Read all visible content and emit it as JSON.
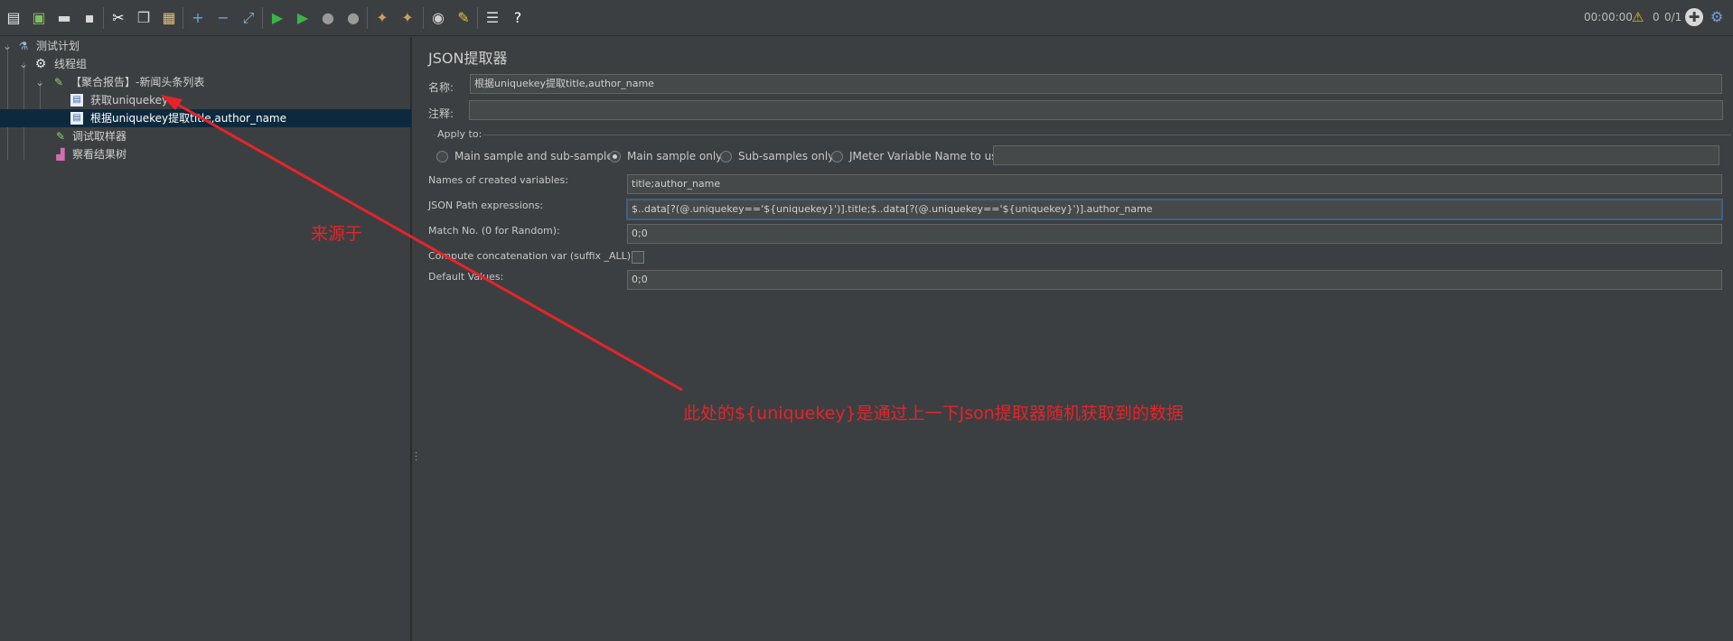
{
  "toolbar": {
    "buttons": [
      {
        "name": "new-icon",
        "glyph": "▤",
        "color": "#e8e8e8"
      },
      {
        "name": "templates-icon",
        "glyph": "▣",
        "color": "#7fbf5f"
      },
      {
        "name": "open-icon",
        "glyph": "▬",
        "color": "#d9d9d9"
      },
      {
        "name": "save-icon",
        "glyph": "▪",
        "color": "#d9d9d9"
      },
      {
        "name": "cut-icon",
        "glyph": "✂",
        "color": "#ffffff"
      },
      {
        "name": "copy-icon",
        "glyph": "❐",
        "color": "#d9d9d9"
      },
      {
        "name": "paste-icon",
        "glyph": "▦",
        "color": "#e0c080"
      },
      {
        "name": "expand-icon",
        "glyph": "+",
        "color": "#5fa8e8"
      },
      {
        "name": "collapse-icon",
        "glyph": "−",
        "color": "#5fa8e8"
      },
      {
        "name": "toggle-icon",
        "glyph": "⤢",
        "color": "#8fb0d0"
      },
      {
        "name": "start-icon",
        "glyph": "▶",
        "color": "#3cb34a"
      },
      {
        "name": "start-no-pauses-icon",
        "glyph": "▶",
        "color": "#3cb34a"
      },
      {
        "name": "stop-icon",
        "glyph": "●",
        "color": "#9a9a9a"
      },
      {
        "name": "shutdown-icon",
        "glyph": "●",
        "color": "#9a9a9a"
      },
      {
        "name": "clear-icon",
        "glyph": "✦",
        "color": "#c8a060"
      },
      {
        "name": "clear-all-icon",
        "glyph": "✦",
        "color": "#c8a060"
      },
      {
        "name": "search-icon",
        "glyph": "◉",
        "color": "#cfcfcf"
      },
      {
        "name": "reset-search-icon",
        "glyph": "✎",
        "color": "#e8c040"
      },
      {
        "name": "function-helper-icon",
        "glyph": "☰",
        "color": "#d9d9d9"
      },
      {
        "name": "help-icon",
        "glyph": "?",
        "color": "#ffffff"
      }
    ],
    "timer": "00:00:00",
    "warnings": "0",
    "threads": "0/1"
  },
  "tree": {
    "nodes": [
      {
        "label": "测试计划",
        "icon": "test-plan-icon",
        "glyph": "⚗",
        "expanded": true
      },
      {
        "label": "线程组",
        "icon": "thread-group-icon",
        "glyph": "⚙",
        "expanded": true
      },
      {
        "label": "【聚合报告】-新闻头条列表",
        "icon": "sampler-icon",
        "glyph": "✎",
        "expanded": true
      },
      {
        "label": "获取uniquekey",
        "icon": "extractor-icon",
        "glyph": "▤"
      },
      {
        "label": "根据uniquekey提取title,author_name",
        "icon": "extractor-icon",
        "glyph": "▤",
        "selected": true
      },
      {
        "label": "调试取样器",
        "icon": "debug-sampler-icon",
        "glyph": "✎"
      },
      {
        "label": "察看结果树",
        "icon": "view-results-tree-icon",
        "glyph": "▟"
      }
    ]
  },
  "panel": {
    "title": "JSON提取器",
    "name_label": "名称:",
    "name_value": "根据uniquekey提取title,author_name",
    "comment_label": "注释:",
    "comment_value": "",
    "apply_to_label": "Apply to:",
    "apply_options": [
      {
        "label": "Main sample and sub-samples",
        "checked": false
      },
      {
        "label": "Main sample only",
        "checked": true
      },
      {
        "label": "Sub-samples only",
        "checked": false
      },
      {
        "label": "JMeter Variable Name to use",
        "checked": false
      }
    ],
    "jmeter_var_value": "",
    "names_label": "Names of created variables:",
    "names_value": "title;author_name",
    "path_label": "JSON Path expressions:",
    "path_value": "$..data[?(@.uniquekey=='${uniquekey}')].title;$..data[?(@.uniquekey=='${uniquekey}')].author_name",
    "match_label": "Match No. (0 for Random):",
    "match_value": "0;0",
    "concat_label": "Compute concatenation var (suffix _ALL):",
    "concat_checked": false,
    "default_label": "Default Values:",
    "default_value": "0;0"
  },
  "annotations": {
    "source_label": "来源于",
    "note": "此处的${uniquekey}是通过上一下Json提取器随机获取到的数据",
    "arrow_color": "#e5242a"
  }
}
